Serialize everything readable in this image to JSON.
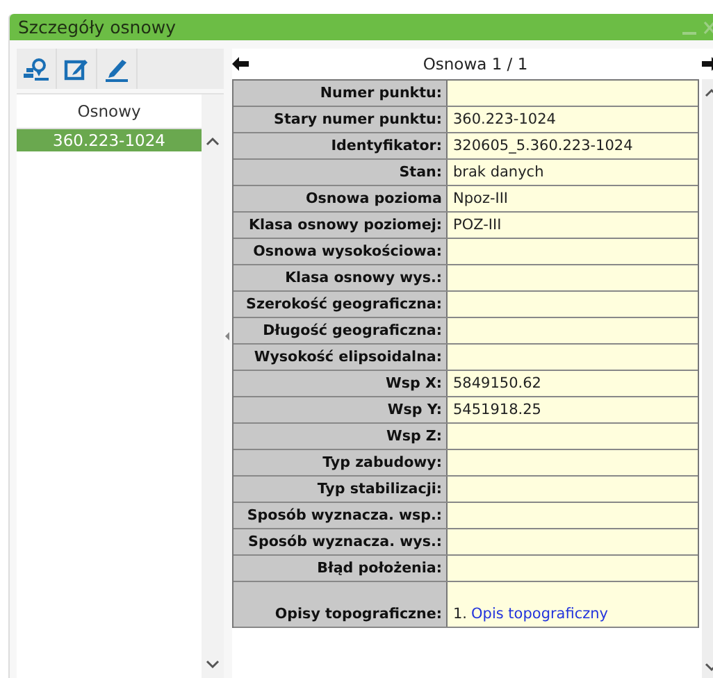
{
  "window": {
    "title": "Szczegóły osnowy"
  },
  "list": {
    "header": "Osnowy",
    "items": [
      {
        "label": "360.223-1024",
        "selected": true
      }
    ]
  },
  "navigator": {
    "label": "Osnowa 1 / 1"
  },
  "fields": [
    {
      "kind": "text",
      "label": "Numer punktu:"
    },
    {
      "kind": "text",
      "label": "Stary numer punktu:",
      "value": "360.223-1024"
    },
    {
      "kind": "text",
      "label": "Identyfikator:",
      "value": "320605_5.360.223-1024"
    },
    {
      "kind": "text",
      "label": "Stan:",
      "value": "brak danych"
    },
    {
      "kind": "text",
      "label": "Osnowa pozioma",
      "value": "Npoz-III"
    },
    {
      "kind": "text",
      "label": "Klasa osnowy poziomej:",
      "value": "POZ-III"
    },
    {
      "kind": "text",
      "label": "Osnowa wysokościowa:"
    },
    {
      "kind": "text",
      "label": "Klasa osnowy wys.:"
    },
    {
      "kind": "text",
      "label": "Szerokość geograficzna:"
    },
    {
      "kind": "text",
      "label": "Długość geograficzna:"
    },
    {
      "kind": "text",
      "label": "Wysokość elipsoidalna:"
    },
    {
      "kind": "text",
      "label": "Wsp X:",
      "value": "5849150.62"
    },
    {
      "kind": "text",
      "label": "Wsp Y:",
      "value": "5451918.25"
    },
    {
      "kind": "text",
      "label": "Wsp Z:"
    },
    {
      "kind": "text",
      "label": "Typ zabudowy:"
    },
    {
      "kind": "text",
      "label": "Typ stabilizacji:"
    },
    {
      "kind": "text",
      "label": "Sposób wyznacza. wsp.:"
    },
    {
      "kind": "text",
      "label": "Sposób wyznacza. wys.:"
    },
    {
      "kind": "text",
      "label": "Błąd położenia:"
    },
    {
      "kind": "link",
      "label": "Opisy topograficzne:",
      "prefix": "1.",
      "value": "Opis topograficzny"
    }
  ]
}
